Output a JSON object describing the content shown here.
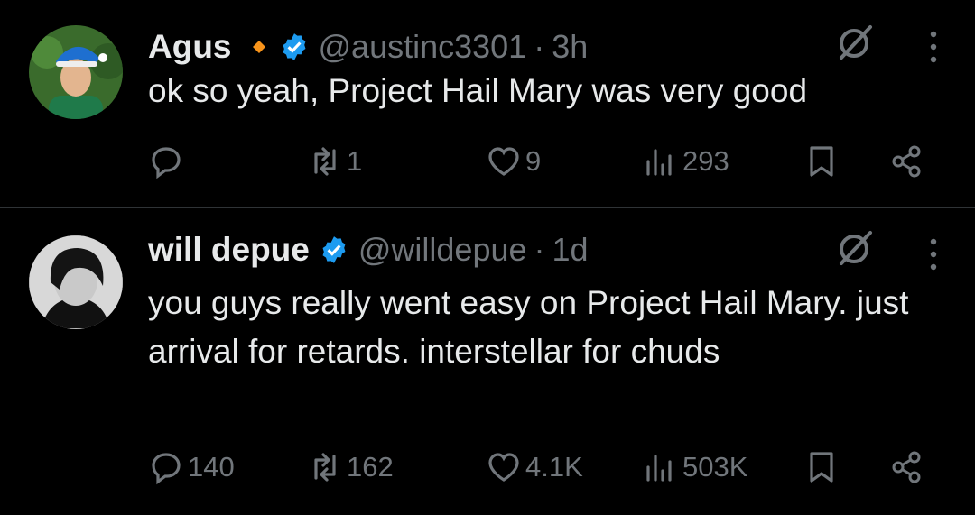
{
  "tweets": [
    {
      "name": "Agus",
      "handle": "@austinc3301",
      "separator": "·",
      "time": "3h",
      "text": "ok so yeah, Project Hail Mary was very good",
      "replies": "",
      "reposts": "1",
      "likes": "9",
      "views": "293"
    },
    {
      "name": "will depue",
      "handle": "@willdepue",
      "separator": "·",
      "time": "1d",
      "text": "you guys really went easy on Project Hail Mary. just arrival for retards.  interstellar for chuds",
      "replies": "140",
      "reposts": "162",
      "likes": "4.1K",
      "views": "503K"
    }
  ],
  "colors": {
    "background": "#000000",
    "text": "#e7e9ea",
    "muted": "#71767b",
    "verified": "#1d9bf0",
    "diamond": "#f7931a",
    "divider": "#2f3336"
  },
  "icons": [
    "reply-icon",
    "repost-icon",
    "like-icon",
    "views-icon",
    "bookmark-icon",
    "share-icon",
    "grok-icon",
    "more-icon",
    "verified-icon"
  ]
}
